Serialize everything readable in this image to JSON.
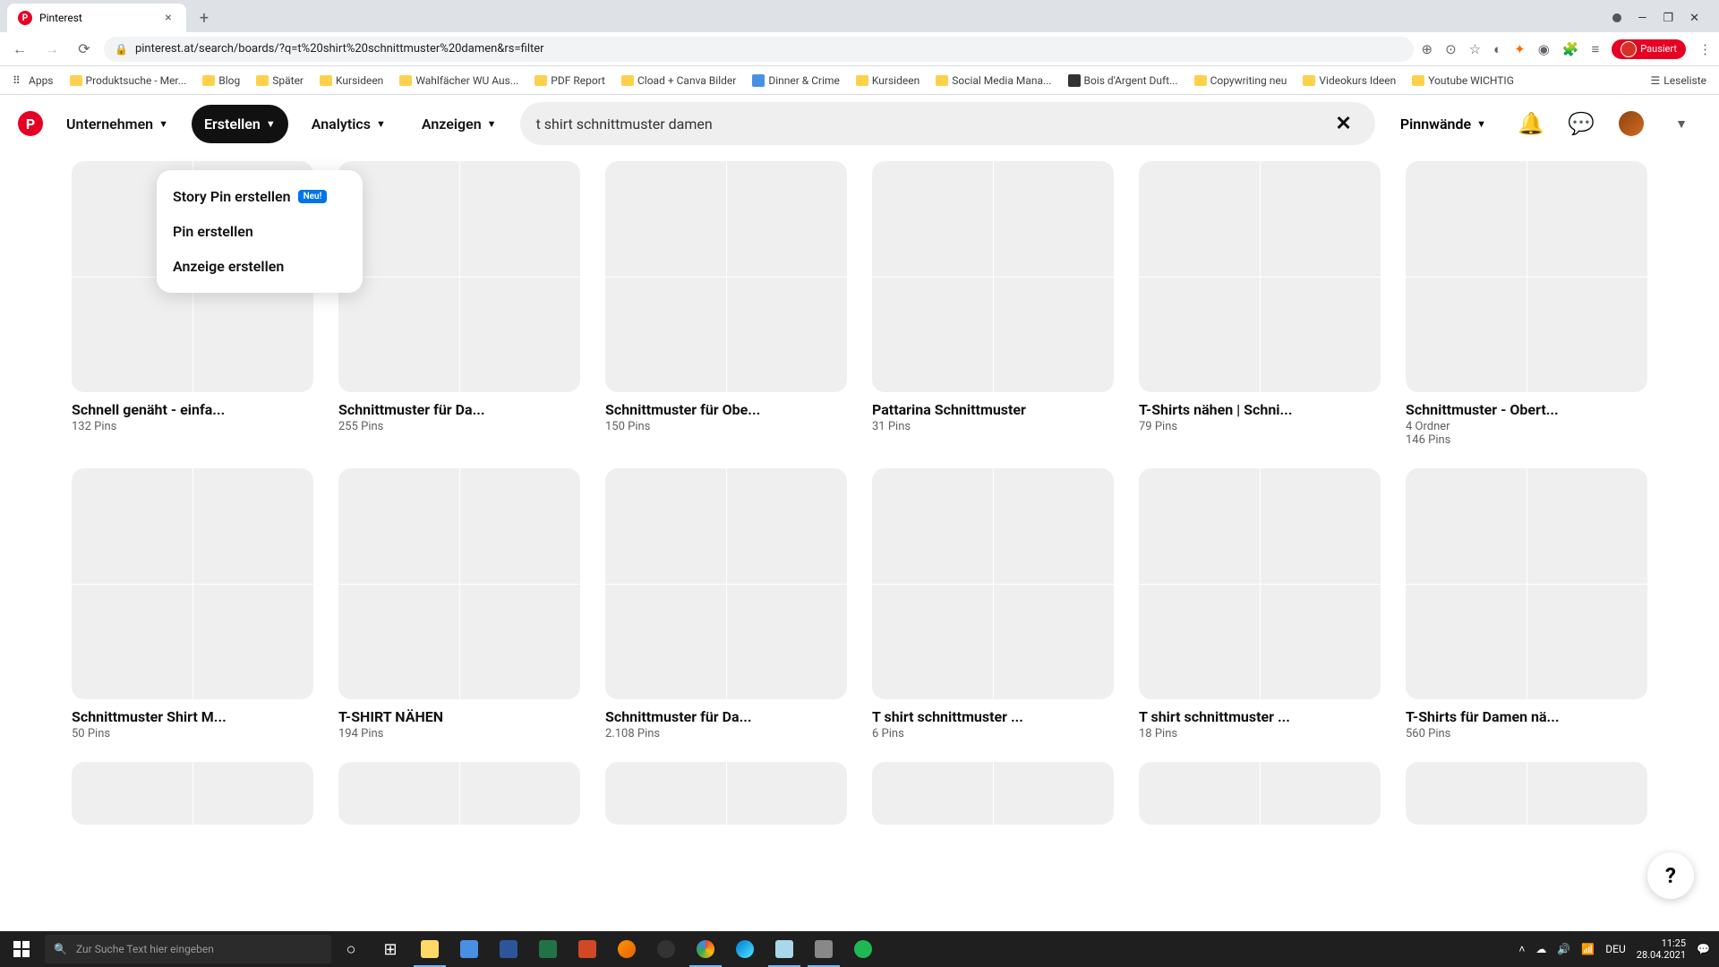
{
  "browser": {
    "tab_title": "Pinterest",
    "url": "pinterest.at/search/boards/?q=t%20shirt%20schnittmuster%20damen&rs=filter",
    "profile_label": "Pausiert",
    "bookmarks": [
      "Apps",
      "Produktsuche - Mer...",
      "Blog",
      "Später",
      "Kursideen",
      "Wahlfächer WU Aus...",
      "PDF Report",
      "Cload + Canva Bilder",
      "Dinner & Crime",
      "Kursideen",
      "Social Media Mana...",
      "Bois d'Argent Duft...",
      "Copywriting neu",
      "Videokurs Ideen",
      "Youtube WICHTIG"
    ],
    "reading_list": "Leseliste"
  },
  "header": {
    "nav": [
      "Unternehmen",
      "Erstellen",
      "Analytics",
      "Anzeigen"
    ],
    "search_value": "t shirt schnittmuster damen",
    "filter_label": "Pinnwände"
  },
  "dropdown": {
    "items": [
      "Story Pin erstellen",
      "Pin erstellen",
      "Anzeige erstellen"
    ],
    "new_badge": "Neu!"
  },
  "boards": [
    {
      "title": "Schnell genäht - einfa...",
      "meta": "132 Pins"
    },
    {
      "title": "Schnittmuster für Da...",
      "meta": "255 Pins"
    },
    {
      "title": "Schnittmuster für Obe...",
      "meta": "150 Pins"
    },
    {
      "title": "Pattarina Schnittmuster",
      "meta": "31 Pins"
    },
    {
      "title": "T-Shirts nähen | Schni...",
      "meta": "79 Pins"
    },
    {
      "title": "Schnittmuster - Obert...",
      "meta": "4 Ordner",
      "meta2": "146 Pins"
    },
    {
      "title": "Schnittmuster Shirt M...",
      "meta": "50 Pins"
    },
    {
      "title": "T-SHIRT NÄHEN",
      "meta": "194 Pins"
    },
    {
      "title": "Schnittmuster für Da...",
      "meta": "2.108 Pins"
    },
    {
      "title": "T shirt schnittmuster ...",
      "meta": "6 Pins"
    },
    {
      "title": "T shirt schnittmuster ...",
      "meta": "18 Pins"
    },
    {
      "title": "T-Shirts für Damen nä...",
      "meta": "560 Pins"
    }
  ],
  "taskbar": {
    "search_placeholder": "Zur Suche Text hier eingeben",
    "lang": "DEU",
    "time": "11:25",
    "date": "28.04.2021"
  },
  "help_label": "?"
}
